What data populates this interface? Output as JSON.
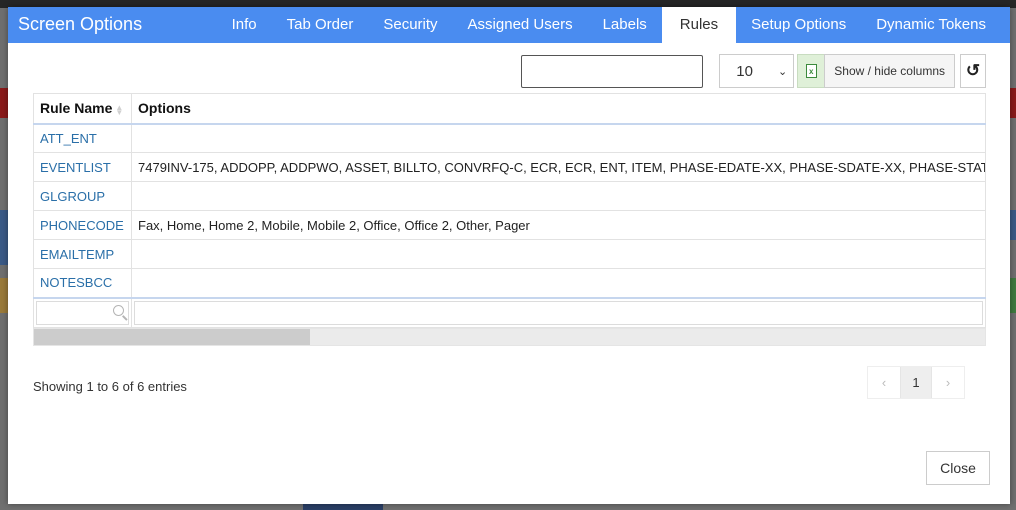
{
  "modal": {
    "title": "Screen Options",
    "tabs": [
      {
        "label": "Info",
        "active": false
      },
      {
        "label": "Tab Order",
        "active": false
      },
      {
        "label": "Security",
        "active": false
      },
      {
        "label": "Assigned Users",
        "active": false
      },
      {
        "label": "Labels",
        "active": false
      },
      {
        "label": "Rules",
        "active": true
      },
      {
        "label": "Setup Options",
        "active": false
      },
      {
        "label": "Dynamic Tokens",
        "active": false
      }
    ]
  },
  "toolbar": {
    "search_value": "",
    "page_length": "10",
    "excel_icon": "excel-export-icon",
    "show_hide_label": "Show / hide columns",
    "reset_icon": "reset-icon"
  },
  "table": {
    "columns": [
      "Rule Name",
      "Options"
    ],
    "rows": [
      {
        "rule": "ATT_ENT",
        "options": ""
      },
      {
        "rule": "EVENTLIST",
        "options": "7479INV-175, ADDOPP, ADDPWO, ASSET, BILLTO, CONVRFQ-C, ECR, ECR, ENT, ITEM, PHASE-EDATE-XX, PHASE-SDATE-XX, PHASE-STAT"
      },
      {
        "rule": "GLGROUP",
        "options": ""
      },
      {
        "rule": "PHONECODE",
        "options": "Fax, Home, Home 2, Mobile, Mobile 2, Office, Office 2, Other, Pager"
      },
      {
        "rule": "EMAILTEMP",
        "options": ""
      },
      {
        "rule": "NOTESBCC",
        "options": ""
      }
    ],
    "filters": {
      "rule_name": "",
      "options": ""
    },
    "scroll_fraction": 0.29
  },
  "footer": {
    "info": "Showing 1 to 6 of 6 entries",
    "prev": "‹",
    "current_page": "1",
    "next": "›",
    "close_label": "Close"
  }
}
